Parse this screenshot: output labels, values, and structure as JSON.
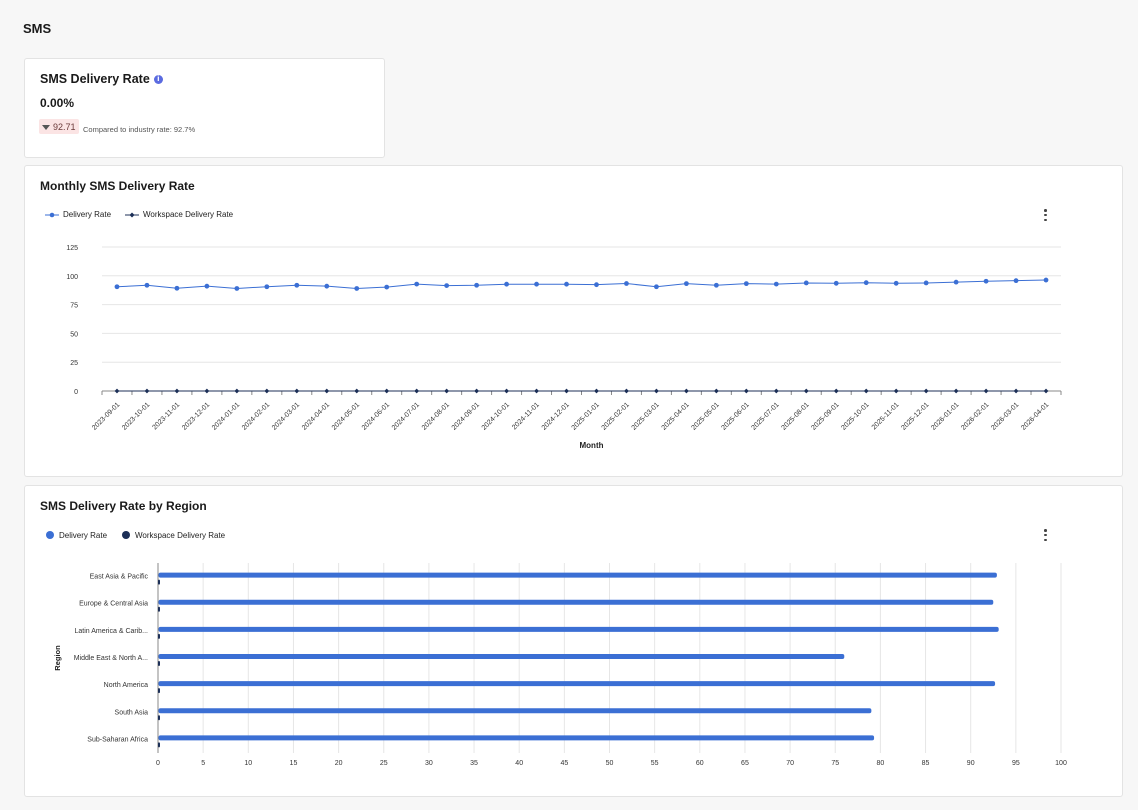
{
  "page": {
    "title": "SMS"
  },
  "kpi": {
    "title": "SMS Delivery Rate",
    "value": "0.00%",
    "delta": "92.71",
    "compare_text": "Compared to industry rate: 92.7%"
  },
  "colors": {
    "delivery": "#3b6fd4",
    "workspace": "#1c2f57",
    "badge_bg": "#fbe4e4",
    "info": "#5b6be0"
  },
  "icons": {
    "info": "info-icon",
    "down": "caret-down-icon",
    "menu": "kebab-menu-icon"
  },
  "monthly": {
    "title": "Monthly SMS Delivery Rate",
    "legend": [
      "Delivery Rate",
      "Workspace Delivery Rate"
    ]
  },
  "region": {
    "title": "SMS Delivery Rate by Region",
    "legend": [
      "Delivery Rate",
      "Workspace Delivery Rate"
    ]
  },
  "chart_data": [
    {
      "type": "line",
      "title": "Monthly SMS Delivery Rate",
      "xlabel": "Month",
      "ylabel": "",
      "ylim": [
        0,
        125
      ],
      "yticks": [
        0,
        25,
        50,
        75,
        100,
        125
      ],
      "grid": true,
      "legend_position": "top-left",
      "categories": [
        "2023-09-01",
        "2023-10-01",
        "2023-11-01",
        "2023-12-01",
        "2024-01-01",
        "2024-02-01",
        "2024-03-01",
        "2024-04-01",
        "2024-05-01",
        "2024-06-01",
        "2024-07-01",
        "2024-08-01",
        "2024-09-01",
        "2024-10-01",
        "2024-11-01",
        "2024-12-01",
        "2025-01-01",
        "2025-02-01",
        "2025-03-01",
        "2025-04-01",
        "2025-05-01",
        "2025-06-01",
        "2025-07-01",
        "2025-08-01",
        "2025-09-01",
        "2025-10-01",
        "2025-11-01",
        "2025-12-01",
        "2026-01-01",
        "2026-02-01",
        "2026-03-01",
        "2026-04-01"
      ],
      "series": [
        {
          "name": "Delivery Rate",
          "values": [
            90.5,
            91.8,
            89.2,
            91,
            89,
            90.5,
            91.8,
            91,
            89,
            90.2,
            92.8,
            91.5,
            91.8,
            92.7,
            92.7,
            92.7,
            92.3,
            93.3,
            90.5,
            93.2,
            91.8,
            93.2,
            92.8,
            93.8,
            93.5,
            94,
            93.5,
            93.8,
            94.5,
            95.3,
            95.8,
            96.3
          ]
        },
        {
          "name": "Workspace Delivery Rate",
          "values": [
            0,
            0,
            0,
            0,
            0,
            0,
            0,
            0,
            0,
            0,
            0,
            0,
            0,
            0,
            0,
            0,
            0,
            0,
            0,
            0,
            0,
            0,
            0,
            0,
            0,
            0,
            0,
            0,
            0,
            0,
            0,
            0
          ]
        }
      ]
    },
    {
      "type": "bar",
      "orientation": "horizontal",
      "title": "SMS Delivery Rate by Region",
      "xlabel": "",
      "ylabel": "Region",
      "xlim": [
        0,
        100
      ],
      "xticks": [
        0,
        5,
        10,
        15,
        20,
        25,
        30,
        35,
        40,
        45,
        50,
        55,
        60,
        65,
        70,
        75,
        80,
        85,
        90,
        95,
        100
      ],
      "grid": true,
      "legend_position": "top-left",
      "categories": [
        "East Asia & Pacific",
        "Europe & Central Asia",
        "Latin America & Carib...",
        "Middle East & North A...",
        "North America",
        "South Asia",
        "Sub-Saharan Africa"
      ],
      "series": [
        {
          "name": "Delivery Rate",
          "values": [
            92.9,
            92.5,
            93.1,
            76,
            92.7,
            79,
            79.3
          ]
        },
        {
          "name": "Workspace Delivery Rate",
          "values": [
            0,
            0,
            0,
            0,
            0,
            0,
            0
          ]
        }
      ]
    }
  ]
}
